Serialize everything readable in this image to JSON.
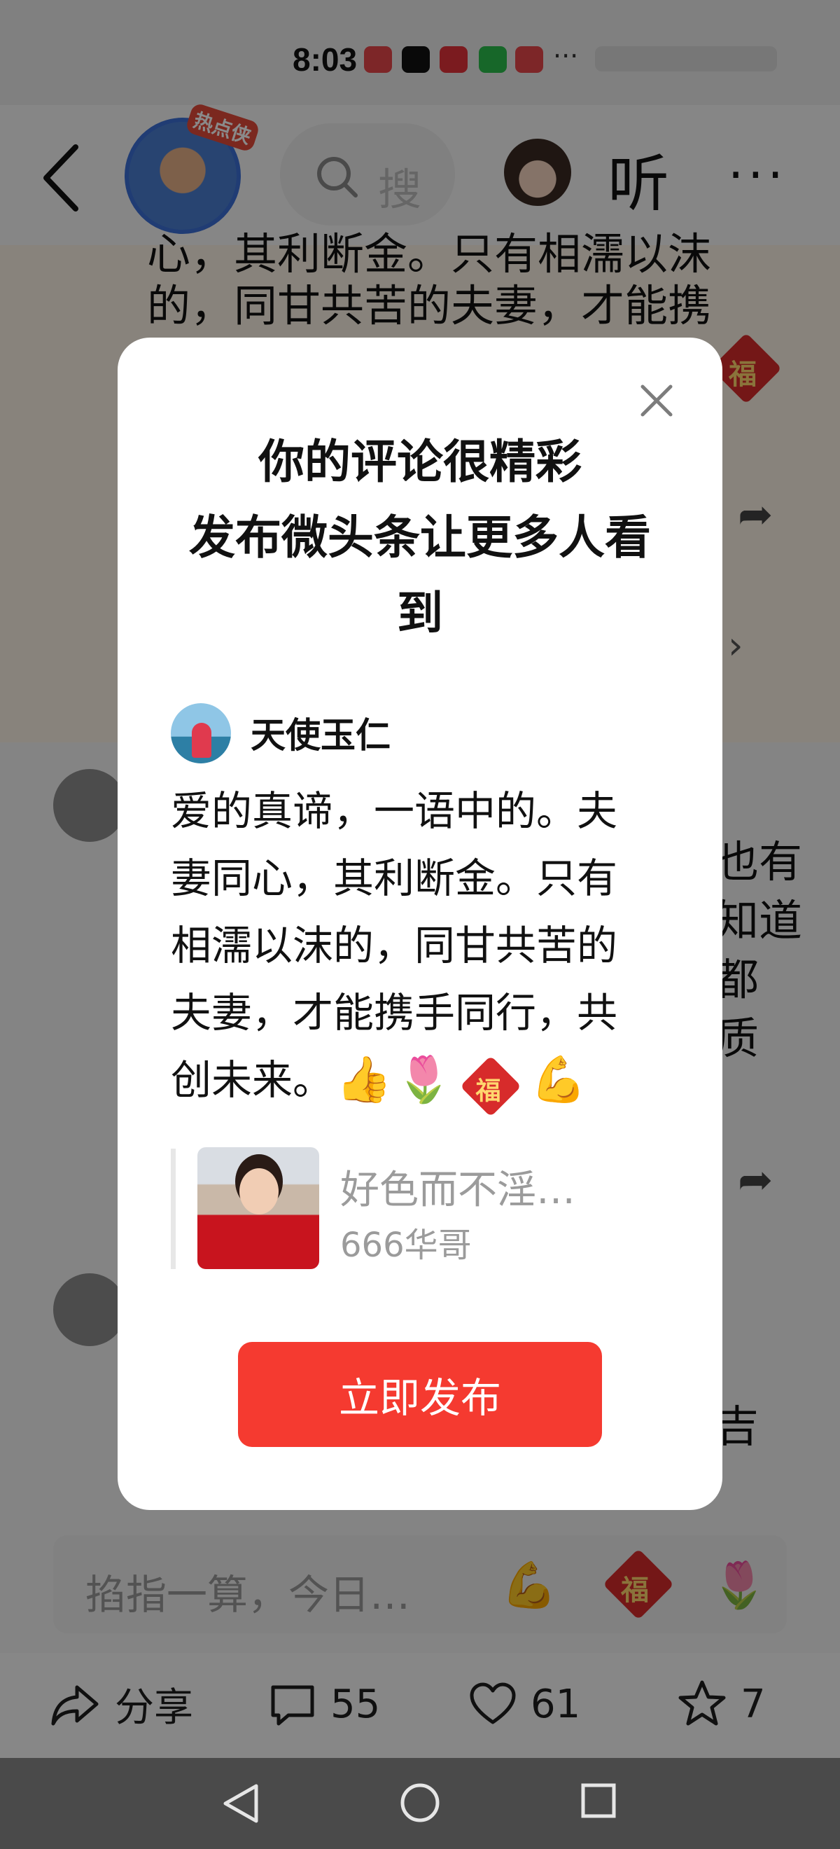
{
  "status_bar": {
    "time": "8:03",
    "more": "···"
  },
  "top_nav": {
    "hot_badge": "热点侠",
    "search_placeholder": "搜",
    "listen_label": "听",
    "more_label": "···"
  },
  "article": {
    "line1": "心，其利断金。只有相濡以沫",
    "line2": "的，同甘共苦的夫妻，才能携"
  },
  "background_comments": {
    "right_fragments": [
      "也有",
      "知道",
      "都",
      "质"
    ],
    "right_fragment_2": "吉"
  },
  "comment_input": {
    "placeholder": "掐指一算，今日…"
  },
  "action_bar": {
    "share_label": "分享",
    "comment_count": "55",
    "like_count": "61",
    "favorite_count": "7"
  },
  "modal": {
    "title": "你的评论很精彩\n发布微头条让更多人看到",
    "author": "天使玉仁",
    "comment": "爱的真谛，一语中的。夫妻同心，其利断金。只有相濡以沫的，同甘共苦的夫妻，才能携手同行，共创未来。",
    "emojis": "👍🌷",
    "fu_char": "福",
    "emoji_tail": "💪",
    "quote_title": "好色而不淫…",
    "quote_author": "666华哥",
    "publish_label": "立即发布"
  }
}
